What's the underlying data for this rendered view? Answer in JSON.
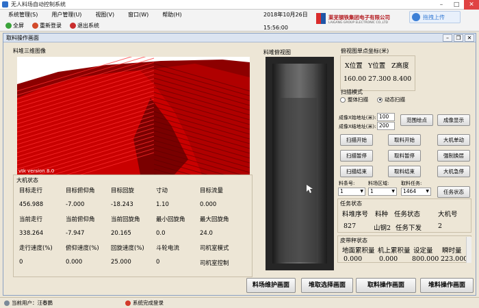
{
  "window": {
    "title": "无人料场自动控制系统"
  },
  "menu": [
    "系统管理(S)",
    "用户管理(U)",
    "视图(V)",
    "窗口(W)",
    "帮助(H)"
  ],
  "toolbar": {
    "fullscreen": "全屏",
    "relogin": "重新登录",
    "logout": "退出系统"
  },
  "header": {
    "date": "2018年10月26日",
    "time": "15:56:00"
  },
  "logo": {
    "cn": "莱芜钢铁集团电子有限公司",
    "en": "LAIGANG GROUP ELECTRONIC CO.,LTD"
  },
  "upload": {
    "label": "拖拽上传"
  },
  "child": {
    "title": "取料操作画面"
  },
  "view3d": {
    "label": "料堆三维图像",
    "watermark": "vtk version 8.0"
  },
  "topview": {
    "label": "料堆俯视图"
  },
  "state": {
    "label": "大机状态",
    "rows": [
      [
        "目标走行",
        "目标俯仰角",
        "目标回旋",
        "寸动",
        "目标流量"
      ],
      [
        "456.988",
        "-7.000",
        "-18.243",
        "1.10",
        "0.000"
      ],
      [
        "当前走行",
        "当前俯仰角",
        "当前回旋角",
        "最小回旋角",
        "最大回旋角"
      ],
      [
        "338.264",
        "-7.947",
        "20.165",
        "0.0",
        "24.0"
      ],
      [
        "走行速度(%)",
        "俯仰速度(%)",
        "回旋速度(%)",
        "斗轮电流",
        "司机室模式"
      ],
      [
        "0",
        "0.000",
        "25.000",
        "0",
        "司机室控制"
      ]
    ]
  },
  "coord": {
    "label": "俯视图单点坐标(米)",
    "heads": [
      "X位置",
      "Y位置",
      "Z高度"
    ],
    "values": [
      "160.00",
      "27.300",
      "8.400"
    ]
  },
  "scan": {
    "label": "扫描模式",
    "options": [
      "整体扫描",
      "动态扫描"
    ],
    "selected": "动态扫描",
    "start_label": "成像X始地址(米):",
    "start_value": "100",
    "end_label": "成像X结地址(米):",
    "end_value": "200"
  },
  "buttons": {
    "range_plot": "范围绘点",
    "image_show": "成像显示",
    "scan_start": "扫描开始",
    "take_start": "取料开始",
    "machine_single": "大机单动",
    "scan_pause": "扫描暂停",
    "take_pause": "取料暂停",
    "force_switch": "强制换层",
    "scan_end": "扫描结束",
    "take_end": "取料结束",
    "machine_stop": "大机急停",
    "task_state": "任务状态"
  },
  "selectors": {
    "strip_label": "料条号:",
    "strip_value": "1",
    "zone_label": "料场区域:",
    "zone_value": "1",
    "task_label": "取料任务:",
    "task_value": "1464"
  },
  "task": {
    "label": "任务状态",
    "heads": [
      "料堆序号",
      "料种",
      "任务状态",
      "大机号"
    ],
    "values": [
      "827",
      "山钢2",
      "任务下发",
      "2"
    ]
  },
  "belt": {
    "label": "皮带秤状态",
    "heads": [
      "地面累积量",
      "机上累积量",
      "设定量",
      "瞬时量"
    ],
    "values": [
      "0.000",
      "0.000",
      "800.000",
      "223.000"
    ]
  },
  "bottom_buttons": [
    "料场维护画面",
    "堆取选择画面",
    "取料操作画面",
    "堆料操作画面"
  ],
  "statusbar": {
    "user_label": "当前用户：",
    "user": "汪春鹏",
    "message": "系统完成登录"
  }
}
